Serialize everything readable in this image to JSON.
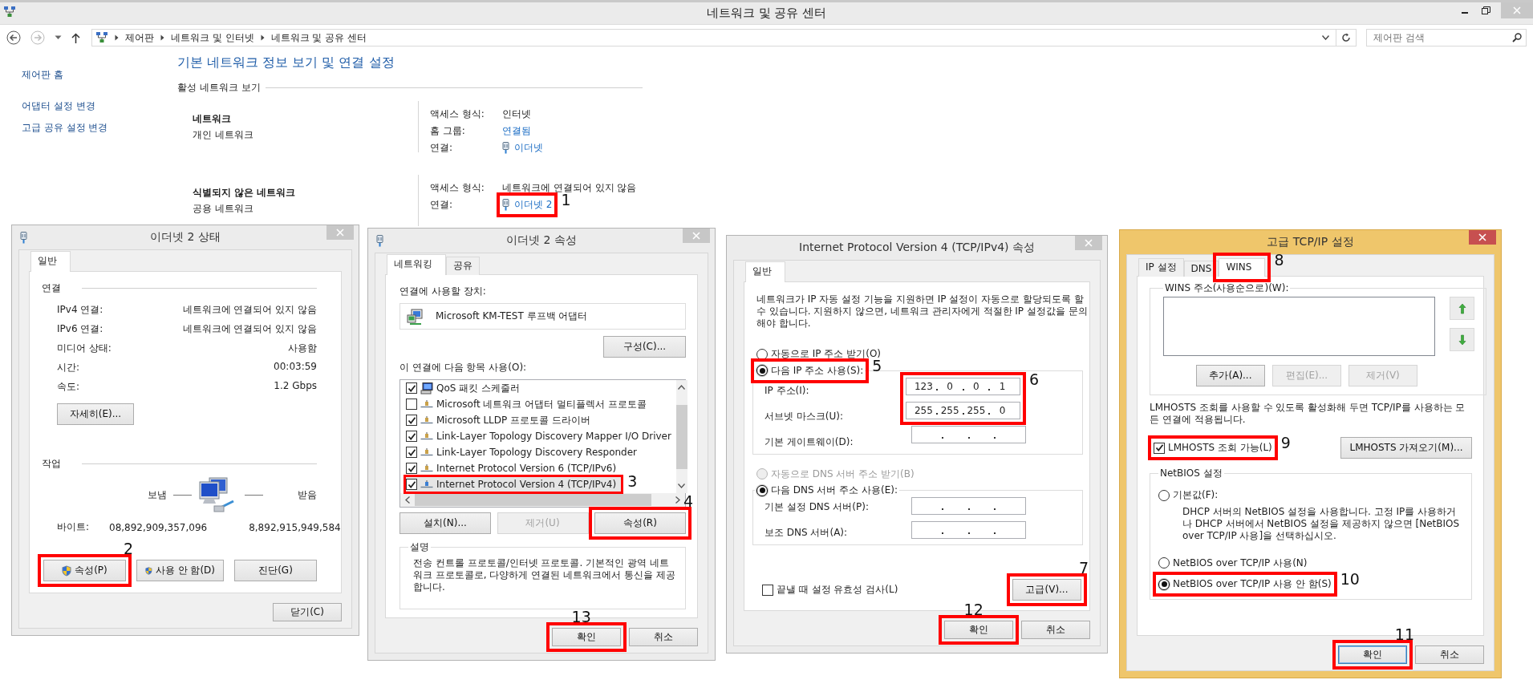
{
  "main_window": {
    "title": "네트워크 및 공유 센터",
    "breadcrumb": [
      "제어판",
      "네트워크 및 인터넷",
      "네트워크 및 공유 센터"
    ],
    "search": {
      "placeholder": "제어판 검색"
    },
    "sidebar": {
      "items": [
        {
          "label": "제어판 홈"
        },
        {
          "label": "어댑터 설정 변경"
        },
        {
          "label": "고급 공유 설정 변경"
        }
      ]
    },
    "heading": "기본 네트워크 정보 보기 및 연결 설정",
    "section": "활성 네트워크 보기",
    "networks": [
      {
        "name": "네트워크",
        "category": "개인 네트워크",
        "properties": [
          {
            "label": "액세스 형식:",
            "value": "인터넷",
            "kind": "text"
          },
          {
            "label": "홈 그룹:",
            "value": "연결됨",
            "kind": "link"
          },
          {
            "label": "연결:",
            "value": "이더넷",
            "kind": "adapter"
          }
        ]
      },
      {
        "name": "식별되지 않은 네트워크",
        "category": "공용 네트워크",
        "properties": [
          {
            "label": "액세스 형식:",
            "value": "네트워크에 연결되어 있지 않음",
            "kind": "text"
          },
          {
            "label": "연결:",
            "value": "이더넷 2",
            "kind": "adapter",
            "highlighted": true,
            "callout": "1"
          }
        ]
      }
    ]
  },
  "status_dialog": {
    "title": "이더넷 2 상태",
    "active": false,
    "tabs": [
      {
        "label": "일반",
        "selected": true
      }
    ],
    "connection": {
      "heading": "연결",
      "rows": [
        {
          "label": "IPv4 연결:",
          "value": "네트워크에 연결되어 있지 않음"
        },
        {
          "label": "IPv6 연결:",
          "value": "네트워크에 연결되어 있지 않음"
        },
        {
          "label": "미디어 상태:",
          "value": "사용함"
        },
        {
          "label": "시간:",
          "value": "00:03:59"
        },
        {
          "label": "속도:",
          "value": "1.2 Gbps"
        }
      ]
    },
    "details_button": "자세히(E)...",
    "activity": {
      "heading": "작업",
      "sent_label": "보냄",
      "received_label": "받음",
      "bytes_label": "바이트:",
      "sent": "08,892,909,357,096",
      "received": "8,892,915,949,584"
    },
    "buttons": [
      {
        "label": "속성(P)",
        "shield": true,
        "highlighted": true,
        "callout": "2"
      },
      {
        "label": "사용 안 함(D)",
        "shield": true
      },
      {
        "label": "진단(G)",
        "shield": false
      }
    ],
    "close_button": "닫기(C)"
  },
  "properties_dialog": {
    "title": "이더넷 2 속성",
    "active": false,
    "tabs": [
      {
        "label": "네트워킹",
        "selected": true
      },
      {
        "label": "공유",
        "selected": false
      }
    ],
    "device_label": "연결에 사용할 장치:",
    "device": "Microsoft KM-TEST 루프백 어댑터",
    "configure_button": "구성(C)...",
    "items_label": "이 연결에 다음 항목 사용(O):",
    "items": [
      {
        "label": "QoS 패킷 스케줄러",
        "kind": "service",
        "checked": true,
        "selected": false
      },
      {
        "label": "Microsoft 네트워크 어댑터 멀티플렉서 프로토콜",
        "kind": "protocol",
        "checked": false,
        "selected": false
      },
      {
        "label": "Microsoft LLDP 프로토콜 드라이버",
        "kind": "protocol",
        "checked": true,
        "selected": false
      },
      {
        "label": "Link-Layer Topology Discovery Mapper I/O Driver",
        "kind": "protocol",
        "checked": true,
        "selected": false
      },
      {
        "label": "Link-Layer Topology Discovery Responder",
        "kind": "protocol",
        "checked": true,
        "selected": false
      },
      {
        "label": "Internet Protocol Version 6 (TCP/IPv6)",
        "kind": "protocol",
        "checked": true,
        "selected": false
      },
      {
        "label": "Internet Protocol Version 4 (TCP/IPv4)",
        "kind": "protocol",
        "checked": true,
        "selected": true,
        "highlighted": true,
        "callout": "3"
      }
    ],
    "buttons": [
      {
        "label": "설치(N)...",
        "disabled": false
      },
      {
        "label": "제거(U)",
        "disabled": true
      },
      {
        "label": "속성(R)",
        "disabled": false,
        "highlighted": true,
        "callout": "4"
      }
    ],
    "description": {
      "heading": "설명",
      "text": "전송 컨트롤 프로토콜/인터넷 프로토콜. 기본적인 광역 네트워크 프로토콜로, 다양하게 연결된 네트워크에서 통신을 제공합니다."
    },
    "footer_buttons": [
      {
        "label": "확인",
        "highlighted": true,
        "callout": "13"
      },
      {
        "label": "취소"
      }
    ]
  },
  "ipv4_dialog": {
    "title": "Internet Protocol Version 4 (TCP/IPv4) 속성",
    "active": false,
    "tabs": [
      {
        "label": "일반",
        "selected": true
      }
    ],
    "intro": "네트워크가 IP 자동 설정 기능을 지원하면 IP 설정이 자동으로 할당되도록 할 수 있습니다. 지원하지 않으면, 네트워크 관리자에게 적절한 IP 설정값을 문의해야 합니다.",
    "ip_options": [
      {
        "label": "자동으로 IP 주소 받기(O)",
        "selected": false,
        "disabled": false
      },
      {
        "label": "다음 IP 주소 사용(S):",
        "selected": true,
        "disabled": false,
        "highlighted": true,
        "callout": "5"
      }
    ],
    "ip_fields": {
      "highlighted": true,
      "callout": "6",
      "fields": [
        {
          "label": "IP 주소(I):",
          "octets": [
            "123",
            "0",
            "0",
            "1"
          ]
        },
        {
          "label": "서브넷 마스크(U):",
          "octets": [
            "255",
            "255",
            "255",
            "0"
          ]
        }
      ]
    },
    "gateway": {
      "label": "기본 게이트웨이(D):"
    },
    "dns_options": [
      {
        "label": "자동으로 DNS 서버 주소 받기(B)",
        "selected": false,
        "disabled": true
      },
      {
        "label": "다음 DNS 서버 주소 사용(E):",
        "selected": true,
        "disabled": false
      }
    ],
    "dns_fields": [
      {
        "label": "기본 설정 DNS 서버(P):"
      },
      {
        "label": "보조 DNS 서버(A):"
      }
    ],
    "validate": {
      "label": "끝낼 때 설정 유효성 검사(L)",
      "checked": false
    },
    "advanced_button": {
      "label": "고급(V)...",
      "highlighted": true,
      "callout": "7"
    },
    "footer_buttons": [
      {
        "label": "확인",
        "highlighted": true,
        "callout": "12"
      },
      {
        "label": "취소"
      }
    ]
  },
  "advanced_dialog": {
    "title": "고급 TCP/IP 설정",
    "active": true,
    "tabs": [
      {
        "label": "IP 설정",
        "selected": false
      },
      {
        "label": "DNS",
        "selected": false
      },
      {
        "label": "WINS",
        "selected": true,
        "highlighted": true,
        "callout": "8"
      }
    ],
    "wins_group": "WINS 주소(사용순으로)(W):",
    "wins_buttons": [
      {
        "label": "추가(A)...",
        "disabled": false
      },
      {
        "label": "편집(E)...",
        "disabled": true
      },
      {
        "label": "제거(V)",
        "disabled": true
      }
    ],
    "lmhosts_note": "LMHOSTS 조회를 사용할 수 있도록 활성화해 두면 TCP/IP를 사용하는 모든 연결에 적용됩니다.",
    "lmhosts_checkbox": {
      "label": "LMHOSTS 조회 가능(L)",
      "checked": true,
      "highlighted": true,
      "callout": "9"
    },
    "import_button": "LMHOSTS 가져오기(M)...",
    "netbios": {
      "heading": "NetBIOS 설정",
      "options": [
        {
          "label": "기본값(F):",
          "description": "DHCP 서버의 NetBIOS 설정을 사용합니다. 고정 IP를 사용하거나 DHCP 서버에서 NetBIOS 설정을 제공하지 않으면 [NetBIOS over TCP/IP 사용]을 선택하십시오.",
          "selected": false
        },
        {
          "label": "NetBIOS over TCP/IP 사용(N)",
          "selected": false
        },
        {
          "label": "NetBIOS over TCP/IP 사용 안 함(S)",
          "selected": true,
          "highlighted": true,
          "callout": "10"
        }
      ]
    },
    "footer_buttons": [
      {
        "label": "확인",
        "default": true,
        "highlighted": true,
        "callout": "11"
      },
      {
        "label": "취소",
        "default": false
      }
    ]
  }
}
